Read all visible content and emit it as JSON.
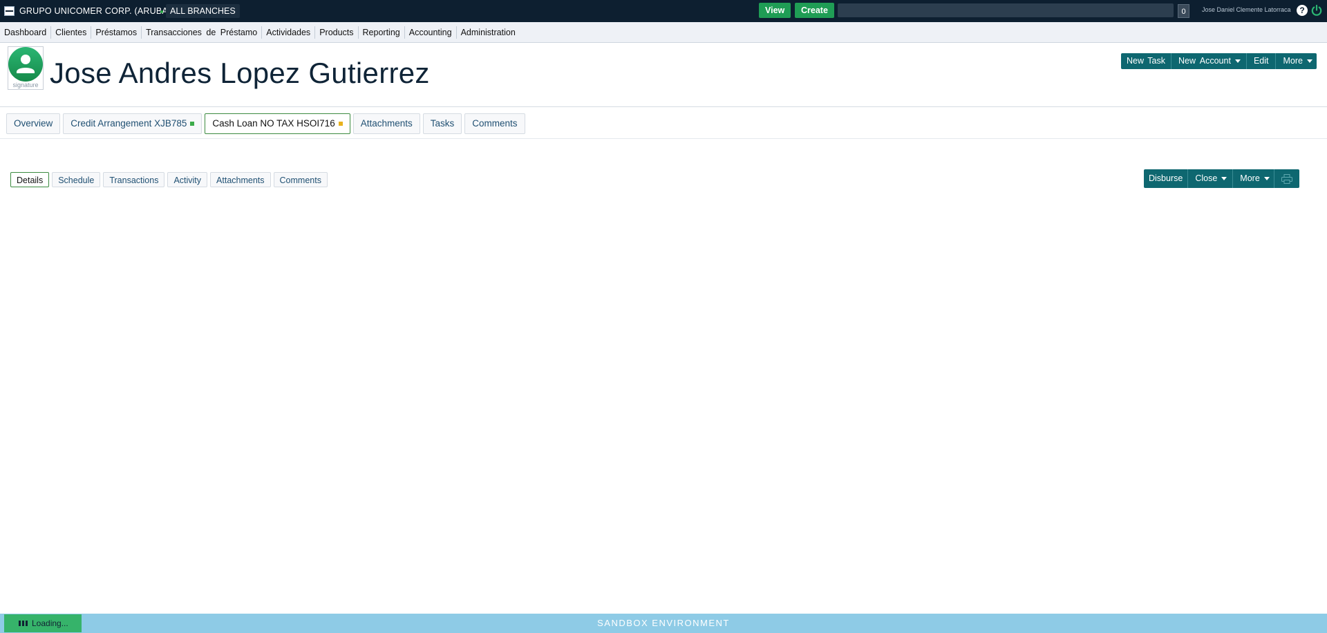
{
  "topbar": {
    "org_name": "GRUPO UNICOMER CORP. (ARUBA)",
    "branch": "ALL BRANCHES",
    "view_label": "View",
    "create_label": "Create",
    "search_placeholder": "",
    "notification_count": "0",
    "user_name": "Jose Daniel Clemente Latorraca",
    "help_glyph": "?"
  },
  "menu": {
    "items": [
      "Dashboard",
      "Clientes",
      "Préstamos",
      "Transacciones de Préstamo",
      "Actividades",
      "Products",
      "Reporting",
      "Accounting",
      "Administration"
    ]
  },
  "client": {
    "signature_label": "signature",
    "name": "Jose Andres Lopez Gutierrez"
  },
  "client_actions": {
    "new_task": "New Task",
    "new_account": "New Account",
    "edit": "Edit",
    "more": "More"
  },
  "account_tabs": [
    {
      "label": "Overview"
    },
    {
      "label": "Credit Arrangement XJB785",
      "status_color": "#3cab4a"
    },
    {
      "label": "Cash Loan NO TAX HSOI716",
      "status_color": "#e8b21e"
    },
    {
      "label": "Attachments"
    },
    {
      "label": "Tasks"
    },
    {
      "label": "Comments"
    }
  ],
  "loan_tabs": [
    "Details",
    "Schedule",
    "Transactions",
    "Activity",
    "Attachments",
    "Comments"
  ],
  "loan_actions": {
    "disburse": "Disburse",
    "close": "Close",
    "more": "More",
    "print_icon": "print-icon"
  },
  "footer": {
    "loading_label": "Loading...",
    "environment_label": "SANDBOX ENVIRONMENT"
  },
  "colors": {
    "topbar": "#0d1f30",
    "accent_green": "#1f9d55",
    "teal": "#0e6770",
    "footer": "#8ecbe6"
  }
}
